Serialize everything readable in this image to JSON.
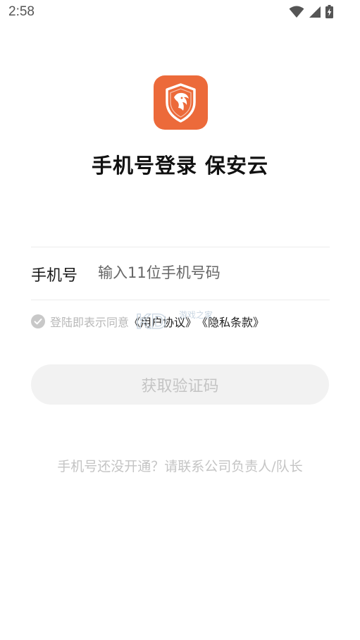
{
  "status_bar": {
    "time": "2:58",
    "icons": [
      "wifi-icon",
      "cell-signal-icon",
      "battery-charging-icon"
    ]
  },
  "app_logo": {
    "icon": "lion-shield-icon",
    "background_color": "#ec6a3a"
  },
  "title": "手机号登录 保安云",
  "phone_form": {
    "label": "手机号",
    "placeholder": "输入11位手机号码",
    "value": ""
  },
  "agreement": {
    "checkbox_icon": "check-circle-icon",
    "prefix_text": "登陆即表示同意",
    "user_agreement_link": "《用户协议》",
    "privacy_link": "《隐私条款》"
  },
  "watermark": {
    "logo_text": "KD",
    "site_text": "游戏之家"
  },
  "get_code_button": {
    "label": "获取验证码",
    "enabled": false
  },
  "footer_hint": "手机号还没开通？请联系公司负责人/队长",
  "colors": {
    "accent": "#ec6a3a",
    "text_primary": "#1a1a1a",
    "text_muted": "#c4c4c4",
    "button_disabled_bg": "#f2f2f2"
  }
}
